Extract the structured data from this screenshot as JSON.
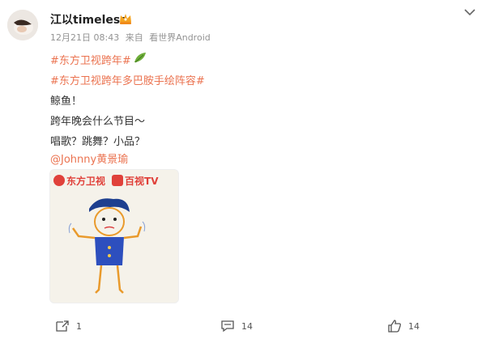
{
  "post": {
    "author": "江以timeless",
    "meta": {
      "time": "12月21日 08:43",
      "source_prefix": "来自",
      "source": "看世界Android"
    },
    "lines": [
      {
        "text": "#东方卫视跨年#",
        "kind": "topic"
      },
      {
        "text": "#东方卫视跨年多巴胺手绘阵容#",
        "kind": "topic"
      },
      {
        "text": "鲸鱼！",
        "kind": "plain"
      },
      {
        "text": "跨年晚会什么节目～",
        "kind": "plain"
      },
      {
        "text": "唱歌？跳舞？小品？",
        "kind": "plain"
      },
      {
        "text": "@Johnny黄景瑜",
        "kind": "topic"
      }
    ],
    "image_card": {
      "logo_left": "东方卫视",
      "logo_right": "百视TV"
    }
  },
  "actions": {
    "repost_count": "1",
    "comment_count": "14",
    "like_count": "14"
  },
  "colors": {
    "topic": "#eb7350",
    "text": "#333333",
    "meta": "#939393",
    "brand_red": "#e0413a"
  },
  "icons": [
    "chevron-down-icon",
    "crown-icon",
    "leaf-icon",
    "repost-icon",
    "comment-icon",
    "like-icon"
  ]
}
